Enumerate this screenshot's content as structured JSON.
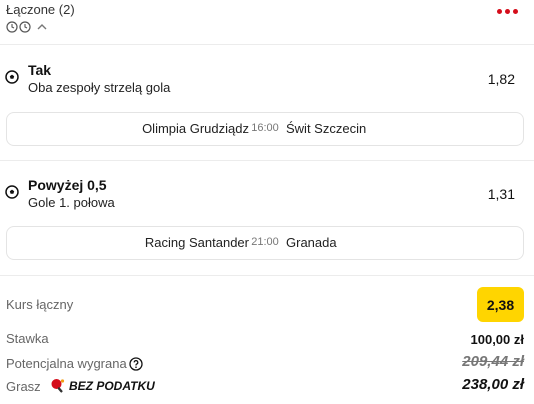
{
  "header": {
    "title": "Łączone (2)",
    "accent_color": "#d50d1b"
  },
  "selections": [
    {
      "name": "Tak",
      "market": "Oba zespoły strzelą gola",
      "odds": "1,82",
      "icon": "soccer-ball-icon",
      "match": {
        "home": "Olimpia Grudziądz",
        "time": "16:00",
        "away": "Świt Szczecin"
      }
    },
    {
      "name": "Powyżej 0,5",
      "market": "Gole 1. połowa",
      "odds": "1,31",
      "icon": "soccer-ball-icon",
      "match": {
        "home": "Racing Santander",
        "time": "21:00",
        "away": "Granada"
      }
    }
  ],
  "summary": {
    "total_odds_label": "Kurs łączny",
    "total_odds": "2,38",
    "total_odds_color": "#ffd500",
    "stake_label": "Stawka",
    "stake": "100,00 zł",
    "potential_win_label": "Potencjalna wygrana",
    "potential_win_old": "209,44 zł",
    "win_label": "Grasz",
    "tax_free_label": "BEZ PODATKU",
    "win_value": "238,00 zł"
  }
}
